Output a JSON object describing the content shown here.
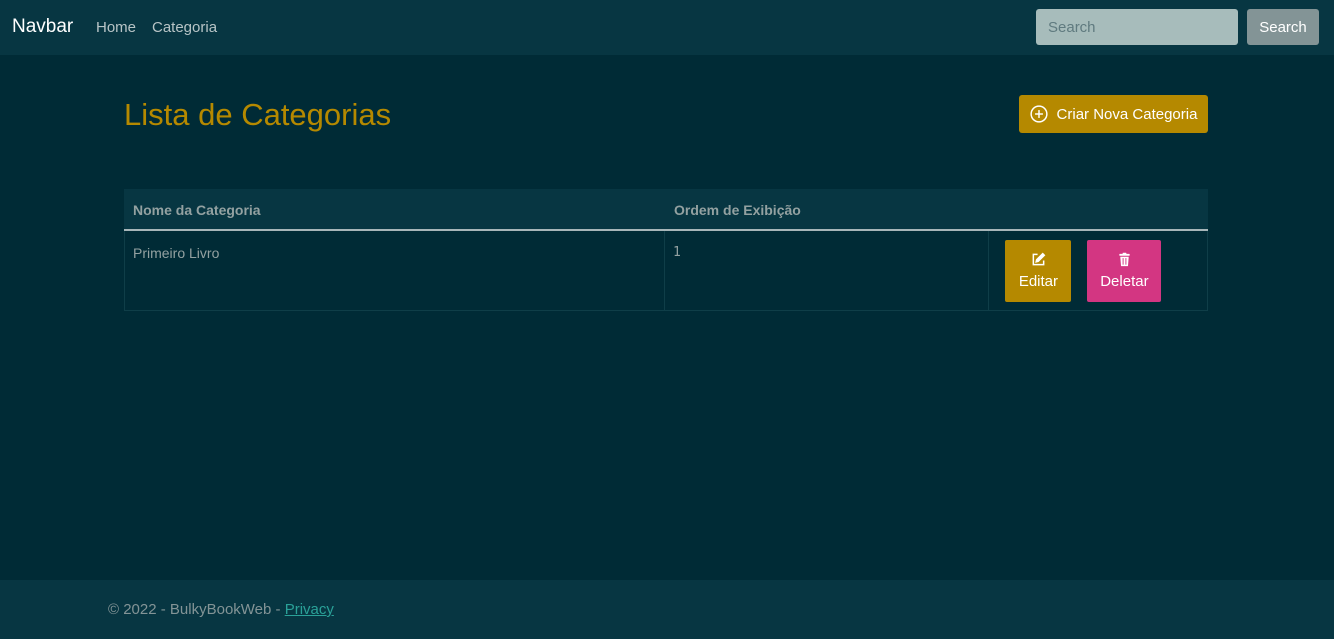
{
  "navbar": {
    "brand": "Navbar",
    "links": [
      {
        "label": "Home"
      },
      {
        "label": "Categoria"
      }
    ],
    "search": {
      "placeholder": "Search",
      "value": "",
      "button_label": "Search"
    }
  },
  "main": {
    "title": "Lista de Categorias",
    "create_button_label": "Criar Nova Categoria",
    "create_button_icon": "plus-circle-icon",
    "table": {
      "columns": [
        "Nome da Categoria",
        "Ordem de Exibição",
        ""
      ],
      "rows": [
        {
          "name": "Primeiro Livro",
          "display_order": "1",
          "edit_label": "Editar",
          "edit_icon": "edit-icon",
          "delete_label": "Deletar",
          "delete_icon": "trash-icon"
        }
      ]
    }
  },
  "footer": {
    "copyright": "© 2022 - BulkyBookWeb - ",
    "privacy_label": "Privacy"
  },
  "colors": {
    "background": "#002b36",
    "navbar": "#073642",
    "accent": "#b58900",
    "danger": "#d33682",
    "link": "#2aa198"
  }
}
